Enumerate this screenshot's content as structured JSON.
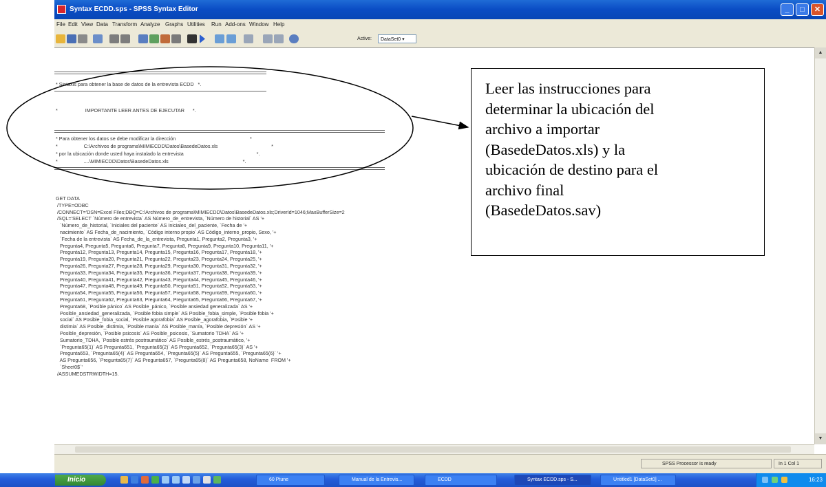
{
  "window": {
    "title": "Syntax ECDD.sps - SPSS Syntax Editor",
    "controls": {
      "minimize": "_",
      "maximize": "□",
      "close": "✕"
    }
  },
  "menu": [
    "File",
    "Edit",
    "View",
    "Data",
    "Transform",
    "Analyze",
    "Graphs",
    "Utilities",
    "Run",
    "Add-ons",
    "Window",
    "Help"
  ],
  "toolbar": {
    "active_label": "Active:",
    "dataset_value": "DataSet0"
  },
  "editor": {
    "comment_lines": [
      "* Sintaxis para obtener la base de datos de la entrevista ECDD   *.",
      "*                    IMPORTANTE LEER ANTES DE EJECUTAR      *.",
      "* Para obtener los datos se debe modificar la dirección                                                      *",
      "*                   C:\\Archivos de programa\\MIMIECDD\\Datos\\BasedeDatos.xls                                       *",
      "* por la ubicación donde usted haya instalado la entrevista                                                     *.",
      "*                   ....\\MIMIECDD\\Datos\\BasedeDatos.xls                                                      *."
    ],
    "code_lines": [
      "GET DATA",
      " /TYPE=ODBC",
      " /CONNECT='DSN=Excel Files;DBQ=C:\\Archivos de programa\\MIMIECDD\\Datos\\BasedeDatos.xls;DriverId=1046;MaxBufferSize=2",
      " /SQL='SELECT `Número de entrevista` AS Número_de_entrevista, `Número de historial` AS '+",
      "   `Número_de_historial, `Iniciales del paciente` AS Iniciales_del_paciente, `Fecha de '+",
      "   nacimiento` AS Fecha_de_nacimiento, `Código interno propio` AS Código_interno_propio, Sexo, '+",
      "   `Fecha de la entrevista` AS Fecha_de_la_entrevista, Pregunta1, Pregunta2, Pregunta3, '+",
      "   Pregunta4, Pregunta5, Pregunta6, Pregunta7, Pregunta8, Pregunta9, Pregunta10, Pregunta11, '+",
      "   Pregunta12, Pregunta13, Pregunta14, Pregunta15, Pregunta16, Pregunta17, Pregunta18, '+",
      "   Pregunta19, Pregunta20, Pregunta21, Pregunta22, Pregunta23, Pregunta24, Pregunta25, '+",
      "   Pregunta26, Pregunta27, Pregunta28, Pregunta29, Pregunta30, Pregunta31, Pregunta32, '+",
      "   Pregunta33, Pregunta34, Pregunta35, Pregunta36, Pregunta37, Pregunta38, Pregunta39, '+",
      "   Pregunta40, Pregunta41, Pregunta42, Pregunta43, Pregunta44, Pregunta45, Pregunta46, '+",
      "   Pregunta47, Pregunta48, Pregunta49, Pregunta50, Pregunta51, Pregunta52, Pregunta53, '+",
      "   Pregunta54, Pregunta55, Pregunta56, Pregunta57, Pregunta58, Pregunta59, Pregunta60, '+",
      "   Pregunta61, Pregunta62, Pregunta63, Pregunta64, Pregunta65, Pregunta66, Pregunta67, '+",
      "   Pregunta68, `Posible pánico` AS Posible_pánico, `Posible ansiedad generalizada` AS '+",
      "   Posible_ansiedad_generalizada, `Posible fobia simple` AS Posible_fobia_simple, `Posible fobia '+",
      "   social` AS Posible_fobia_social, `Posible agorafobia` AS Posible_agorafobia, `Posible '+",
      "   distimia` AS Posible_distimia, `Posible manía` AS Posible_manía, `Posible depresión` AS '+",
      "   Posible_depresión, `Posible psicosis` AS Posible_psicosis, `Sumatorio TDHA` AS '+",
      "   Sumatorio_TDHA, `Posible estrés postraumático` AS Posible_estrés_postraumático, '+",
      "   `Pregunta65(1)` AS Pregunta651, `Pregunta65(2)` AS Pregunta652, `Pregunta65(3)` AS '+",
      "   Pregunta653, `Pregunta65(4)` AS Pregunta654, `Pregunta65(5)` AS Pregunta655, `Pregunta65(6)` '+",
      "   AS Pregunta656, `Pregunta65(7)` AS Pregunta657, `Pregunta65(8)` AS Pregunta658, NoName  FROM '+",
      "   `Sheet0$`'",
      " /ASSUMEDSTRWIDTH=15."
    ]
  },
  "callout": {
    "lines": [
      "Leer las instrucciones para",
      "determinar la ubicación del",
      "archivo a importar",
      "(BasedeDatos.xls) y la",
      "ubicación de destino para el",
      "archivo final",
      "(BasedeDatos.sav)"
    ]
  },
  "statusbar": {
    "processor": "SPSS Processor is ready",
    "position": "In 1 Col 1"
  },
  "taskbar": {
    "start": "Inicio",
    "tasks": [
      {
        "label": "60 Ptune"
      },
      {
        "label": "Manual de la Entrevis..."
      },
      {
        "label": "ECDD"
      },
      {
        "label": "Syntax ECDD.sps - S..."
      },
      {
        "label": "Untitled1 [DataSet0] ..."
      }
    ],
    "clock": "16:23"
  },
  "colors": {
    "titlebar": "#0a4cc4",
    "taskbar": "#245edb",
    "start_button": "#348833",
    "ellipse": "#000000"
  }
}
